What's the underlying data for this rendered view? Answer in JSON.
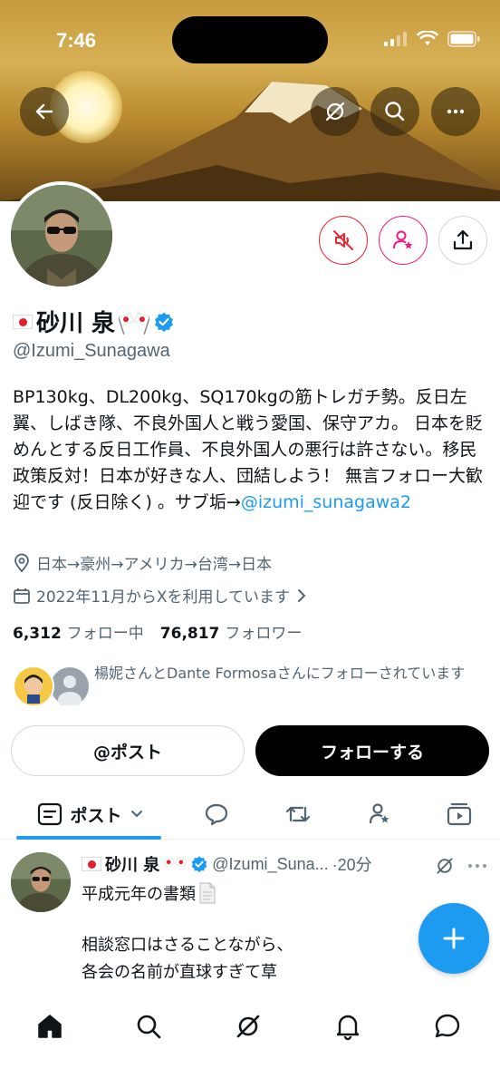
{
  "status_bar": {
    "time": "7:46"
  },
  "profile": {
    "name": "砂川 泉",
    "handle": "@Izumi_Sunagawa",
    "bio_text": "BP130kg、DL200kg、SQ170kgの筋トレガチ勢。反日左翼、しばき隊、不良外国人と戦う愛国、保守アカ。 日本を貶めんとする反日工作員、不良外国人の悪行は許さない。移民政策反対！日本が好きな人、団結しよう！ 無言フォロー大歓迎です (反日除く) 。サブ垢→",
    "bio_link": "@izumi_sunagawa2",
    "location": "日本→豪州→アメリカ→台湾→日本",
    "joined": "2022年11月からXを利用しています",
    "following_count": "6,312",
    "following_label": "フォロー中",
    "followers_count": "76,817",
    "followers_label": "フォロワー",
    "mutual_text": "楊妮さんとDante Formosaさんにフォローされています"
  },
  "buttons": {
    "mention": "@ポスト",
    "follow": "フォローする"
  },
  "tabs": {
    "posts_label": "ポスト"
  },
  "post": {
    "name": "砂川 泉",
    "handle": "@Izumi_Suna...",
    "time": "·20分",
    "line1": "平成元年の書類",
    "line2": "相談窓口はさることながら、",
    "line3": "各会の名前が直球すぎて草"
  },
  "colors": {
    "accent": "#1d9bf0",
    "mute_red": "#f4212e",
    "notify_pink": "#f91880"
  },
  "icons": [
    "back-arrow-icon",
    "grok-icon",
    "search-icon",
    "more-icon",
    "muted-icon",
    "notify-user-icon",
    "share-icon",
    "location-icon",
    "calendar-icon",
    "verified-icon",
    "posts-icon",
    "reply-icon",
    "repost-icon",
    "highlights-icon",
    "media-icon",
    "compose-icon",
    "home-icon",
    "explore-icon",
    "grok-nav-icon",
    "notifications-icon",
    "messages-icon"
  ]
}
